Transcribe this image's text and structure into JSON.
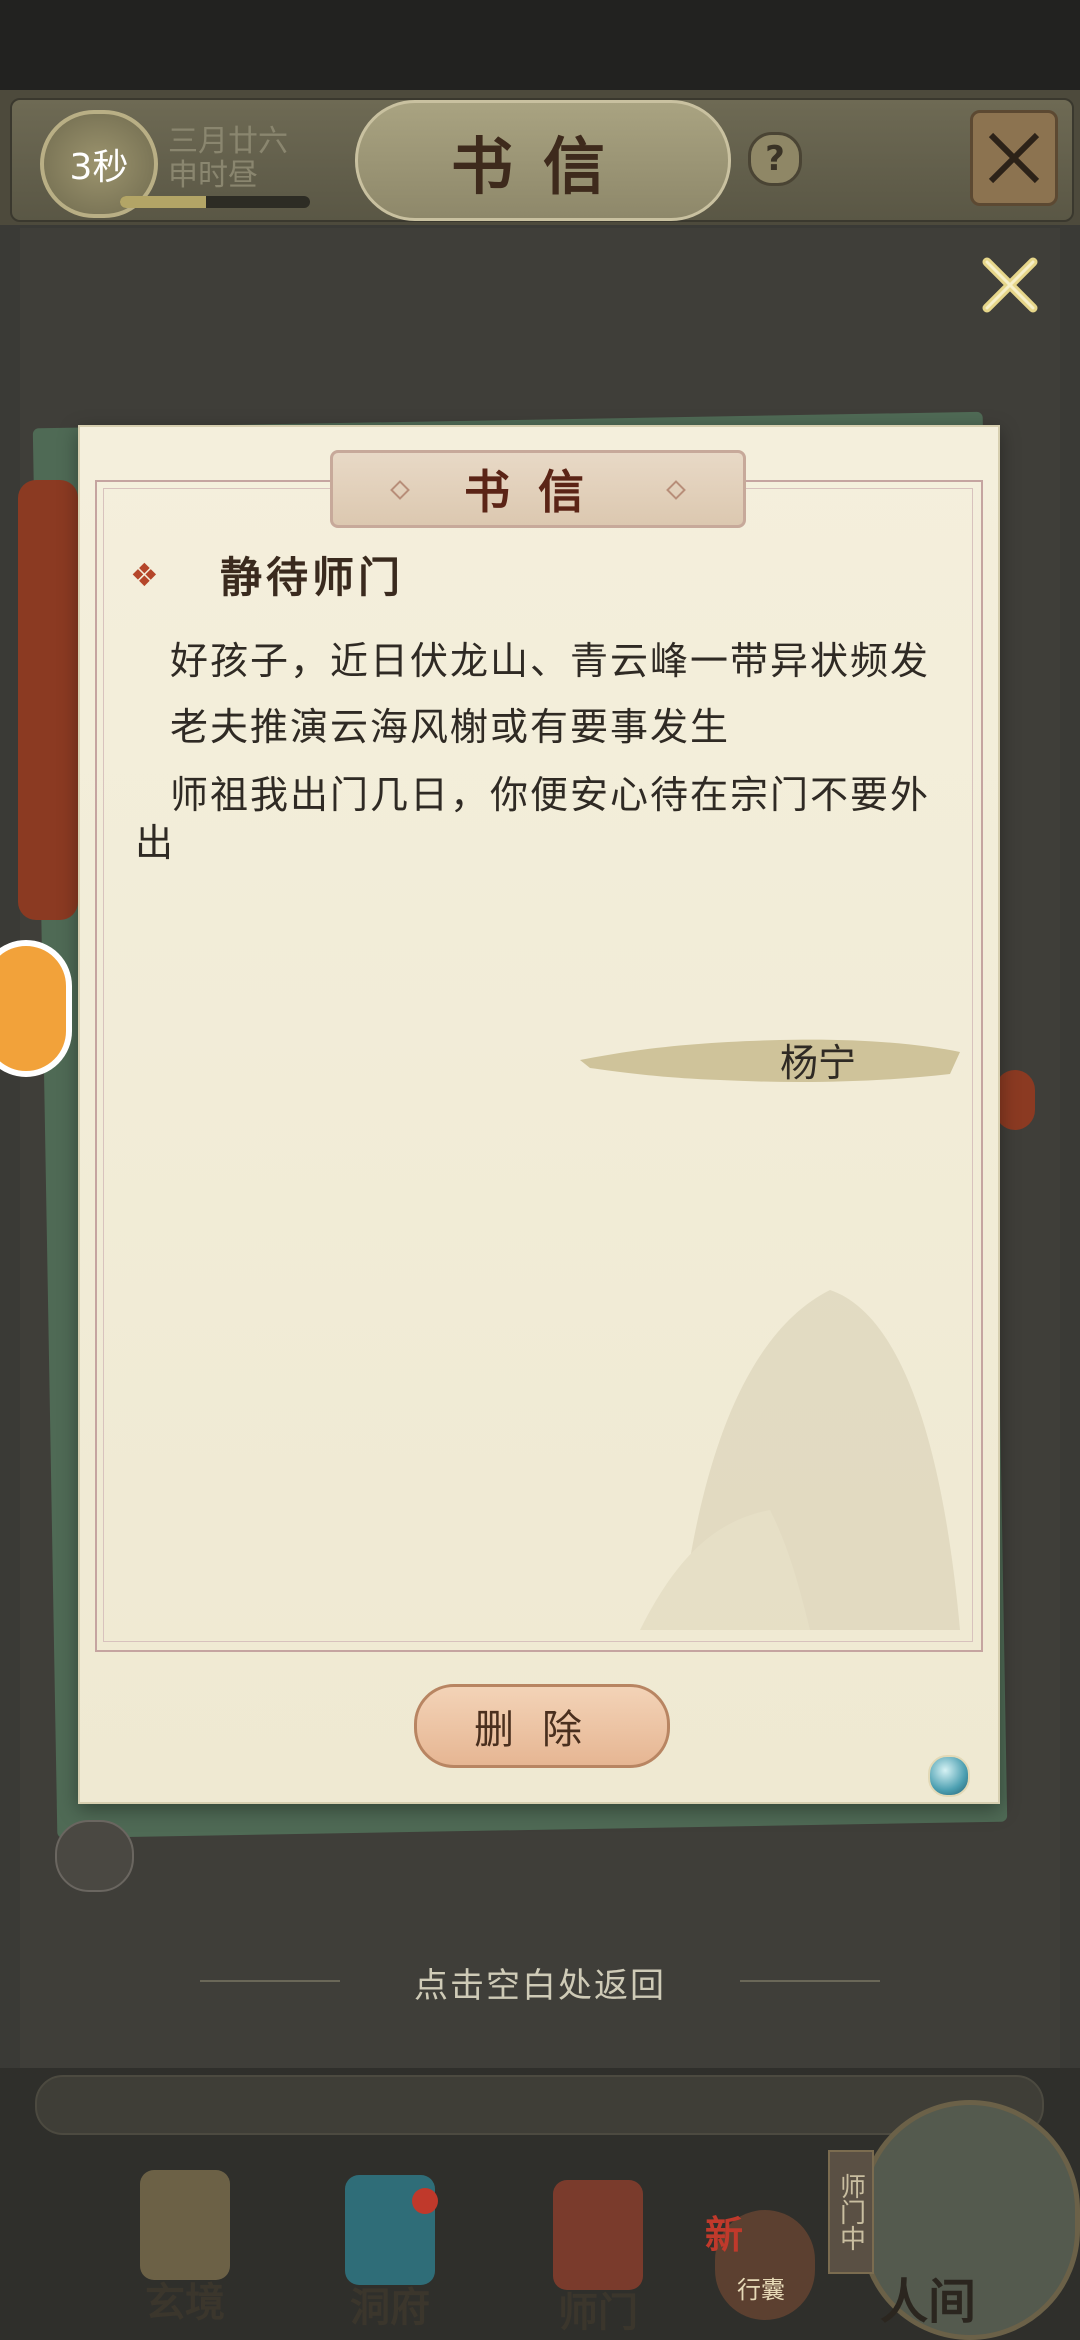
{
  "topbar": {
    "timer": "3秒",
    "date_line_1": "三月廿六",
    "date_line_2": "申时昼",
    "time_progress": 0.45,
    "title": "书信",
    "help_icon": "question-icon",
    "map_icon": "map-icon",
    "close_icon": "close-icon"
  },
  "letter": {
    "plaque_title": "书信",
    "subject_marker": "❖",
    "subject": "静待师门",
    "lines": [
      "好孩子，近日伏龙山、青云峰一带异状频发",
      "老夫推演云海风榭或有要事发生",
      "师祖我出门几日，你便安心待在宗门不要外",
      "出"
    ],
    "signature": "杨宁",
    "delete_label": "删除"
  },
  "hint": {
    "return_text": "点击空白处返回"
  },
  "bottom_nav": {
    "items": [
      {
        "label": "玄境",
        "icon": "scroll-icon"
      },
      {
        "label": "洞府",
        "icon": "pavilion-icon"
      },
      {
        "label": "师门",
        "icon": "banner-icon"
      },
      {
        "label": "行囊",
        "icon": "bag-icon"
      }
    ],
    "renjian_label": "人间",
    "shimen_tag": "师门中",
    "xingnang_badge": "新"
  },
  "colors": {
    "accent_red": "#8b3a22",
    "paper": "#f4efdc",
    "button": "#e6b693"
  }
}
